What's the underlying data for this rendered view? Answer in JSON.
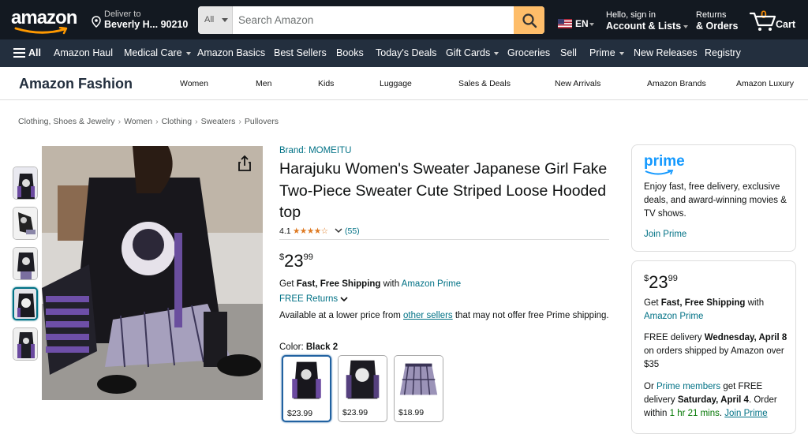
{
  "header": {
    "logo_text": "amazon",
    "deliver_line1": "Deliver to",
    "deliver_line2": "Beverly H... 90210",
    "search_category": "All",
    "search_placeholder": "Search Amazon",
    "language": "EN",
    "account_line1": "Hello, sign in",
    "account_line2": "Account & Lists",
    "orders_line1": "Returns",
    "orders_line2": "& Orders",
    "cart_count": "0",
    "cart_label": "Cart"
  },
  "subnav": {
    "all_label": "All",
    "items": [
      "Amazon Haul",
      "Medical Care",
      "Amazon Basics",
      "Best Sellers",
      "Books",
      "Today's Deals",
      "Gift Cards",
      "Groceries",
      "Sell",
      "Prime",
      "New Releases",
      "Registry"
    ]
  },
  "fashion_nav": {
    "brand": "Amazon Fashion",
    "items": [
      "Women",
      "Men",
      "Kids",
      "Luggage",
      "Sales & Deals",
      "New Arrivals",
      "Amazon Brands",
      "Amazon Luxury"
    ]
  },
  "breadcrumbs": [
    "Clothing, Shoes & Jewelry",
    "Women",
    "Clothing",
    "Sweaters",
    "Pullovers"
  ],
  "product": {
    "brand": "Brand: MOMEITU",
    "title": "Harajuku Women's Sweater Japanese Girl Fake Two-Piece Sweater Cute Striped Loose Hooded top",
    "rating": "4.1",
    "rating_value": 4.1,
    "stars_glyphs": "★★★★☆",
    "review_count": "(55)",
    "price_symbol": "$",
    "price_whole": "23",
    "price_fraction": "99",
    "shipping_prefix": "Get ",
    "shipping_bold": "Fast, Free Shipping",
    "shipping_mid": " with ",
    "shipping_link": "Amazon Prime",
    "free_returns": "FREE Returns",
    "lower_price_prefix": "Available at a lower price from ",
    "lower_price_link": "other sellers",
    "lower_price_suffix": " that may not offer free Prime shipping.",
    "color_label": "Color: ",
    "color_value": "Black 2",
    "swatches": [
      {
        "price": "$23.99"
      },
      {
        "price": "$23.99"
      },
      {
        "price": "$18.99"
      }
    ]
  },
  "prime_box": {
    "logo": "prime",
    "description": "Enjoy fast, free delivery, exclusive deals, and award-winning movies & TV shows.",
    "join_label": "Join Prime"
  },
  "buy_box": {
    "price_symbol": "$",
    "price_whole": "23",
    "price_fraction": "99",
    "shipping_prefix": "Get ",
    "shipping_bold": "Fast, Free Shipping",
    "shipping_mid": " with ",
    "shipping_link": "Amazon Prime",
    "delivery_prefix": "FREE delivery ",
    "delivery_date": "Wednesday, April 8",
    "delivery_suffix": " on orders shipped by Amazon over $35",
    "or_prefix": "Or ",
    "prime_members_link": "Prime members",
    "or_mid": " get FREE delivery ",
    "fast_date": "Saturday, April 4",
    "order_within_prefix": ". Order within ",
    "countdown": "1 hr 21 mins",
    "join_link": "Join Prime"
  },
  "colors": {
    "nav_dark": "#131921",
    "nav_secondary": "#232f3e",
    "search_button": "#febd69",
    "link": "#007185",
    "star": "#de7921",
    "prime_blue": "#1399ff",
    "cart_count": "#f08804"
  },
  "icons": [
    "location-pin-icon",
    "search-icon",
    "us-flag-icon",
    "cart-icon",
    "hamburger-menu-icon",
    "share-icon",
    "chevron-down-icon"
  ]
}
